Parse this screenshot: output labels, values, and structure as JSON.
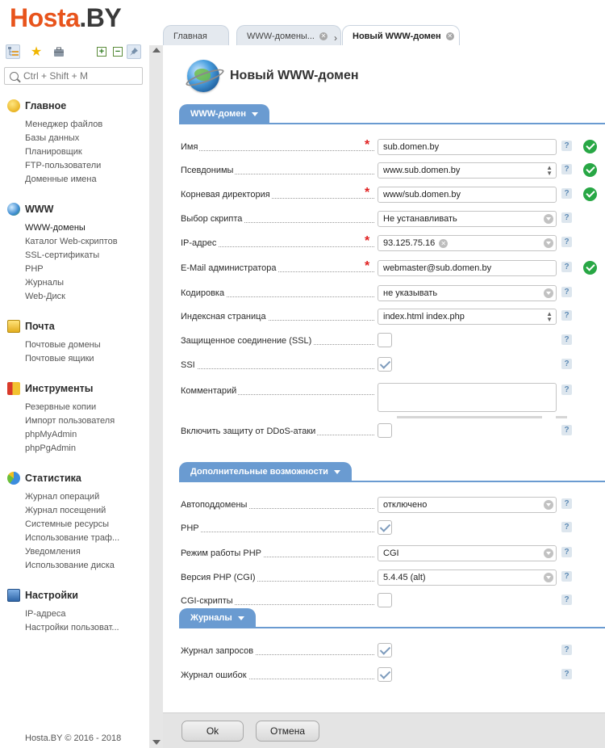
{
  "brand": {
    "logo_part1": "Hosta",
    "logo_part2": ".BY"
  },
  "search": {
    "placeholder": "Ctrl + Shift + M"
  },
  "sidebar": {
    "sections": [
      {
        "title": "Главное",
        "icon": "home-icon",
        "items": [
          "Менеджер файлов",
          "Базы данных",
          "Планировщик",
          "FTP-пользователи",
          "Доменные имена"
        ]
      },
      {
        "title": "WWW",
        "icon": "globe-icon",
        "items": [
          "WWW-домены",
          "Каталог Web-скриптов",
          "SSL-сертификаты",
          "PHP",
          "Журналы",
          "Web-Диск"
        ]
      },
      {
        "title": "Почта",
        "icon": "mail-icon",
        "items": [
          "Почтовые домены",
          "Почтовые ящики"
        ]
      },
      {
        "title": "Инструменты",
        "icon": "tools-icon",
        "items": [
          "Резервные копии",
          "Импорт пользователя",
          "phpMyAdmin",
          "phpPgAdmin"
        ]
      },
      {
        "title": "Статистика",
        "icon": "chart-icon",
        "items": [
          "Журнал операций",
          "Журнал посещений",
          "Системные ресурсы",
          "Использование траф...",
          "Уведомления",
          "Использование диска"
        ]
      },
      {
        "title": "Настройки",
        "icon": "settings-icon",
        "items": [
          "IP-адреса",
          "Настройки пользоват..."
        ]
      }
    ],
    "active_item": "WWW-домены",
    "footer": "Hosta.BY © 2016 - 2018"
  },
  "tabs": [
    {
      "label": "Главная",
      "closable": false
    },
    {
      "label": "WWW-домены...",
      "closable": true
    },
    {
      "label": "Новый WWW-домен",
      "closable": true,
      "active": true
    }
  ],
  "page": {
    "title": "Новый WWW-домен"
  },
  "groups": {
    "www": {
      "title": "WWW-домен",
      "fields": {
        "name": {
          "label": "Имя",
          "value": "sub.domen.by"
        },
        "aliases": {
          "label": "Псевдонимы",
          "value": "www.sub.domen.by"
        },
        "root_dir": {
          "label": "Корневая директория",
          "value": "www/sub.domen.by"
        },
        "script": {
          "label": "Выбор скрипта",
          "value": "Не устанавливать"
        },
        "ip": {
          "label": "IP-адрес",
          "value": "93.125.75.16"
        },
        "email": {
          "label": "E-Mail администратора",
          "value": "webmaster@sub.domen.by"
        },
        "charset": {
          "label": "Кодировка",
          "value": "не указывать"
        },
        "index": {
          "label": "Индексная страница",
          "value": "index.html index.php"
        },
        "ssl": {
          "label": "Защищенное соединение (SSL)",
          "checked": false
        },
        "ssi": {
          "label": "SSI",
          "checked": true
        },
        "comment": {
          "label": "Комментарий",
          "value": ""
        },
        "ddos": {
          "label": "Включить защиту от DDoS-атаки",
          "checked": false
        }
      }
    },
    "extra": {
      "title": "Дополнительные возможности",
      "fields": {
        "autosub": {
          "label": "Автоподдомены",
          "value": "отключено"
        },
        "php": {
          "label": "PHP",
          "checked": true
        },
        "php_mode": {
          "label": "Режим работы PHP",
          "value": "CGI"
        },
        "php_version": {
          "label": "Версия PHP (CGI)",
          "value": "5.4.45 (alt)"
        },
        "cgi": {
          "label": "CGI-скрипты",
          "checked": false
        }
      }
    },
    "logs": {
      "title": "Журналы",
      "fields": {
        "access_log": {
          "label": "Журнал запросов",
          "checked": true
        },
        "error_log": {
          "label": "Журнал ошибок",
          "checked": true
        }
      }
    }
  },
  "help_glyph": "?",
  "required_mark": "*",
  "buttons": {
    "ok": "Ok",
    "cancel": "Отмена"
  },
  "colors": {
    "brand_orange": "#e8541c",
    "group_blue": "#6a9bd1",
    "valid_green": "#28a745",
    "required_red": "#e02020"
  }
}
